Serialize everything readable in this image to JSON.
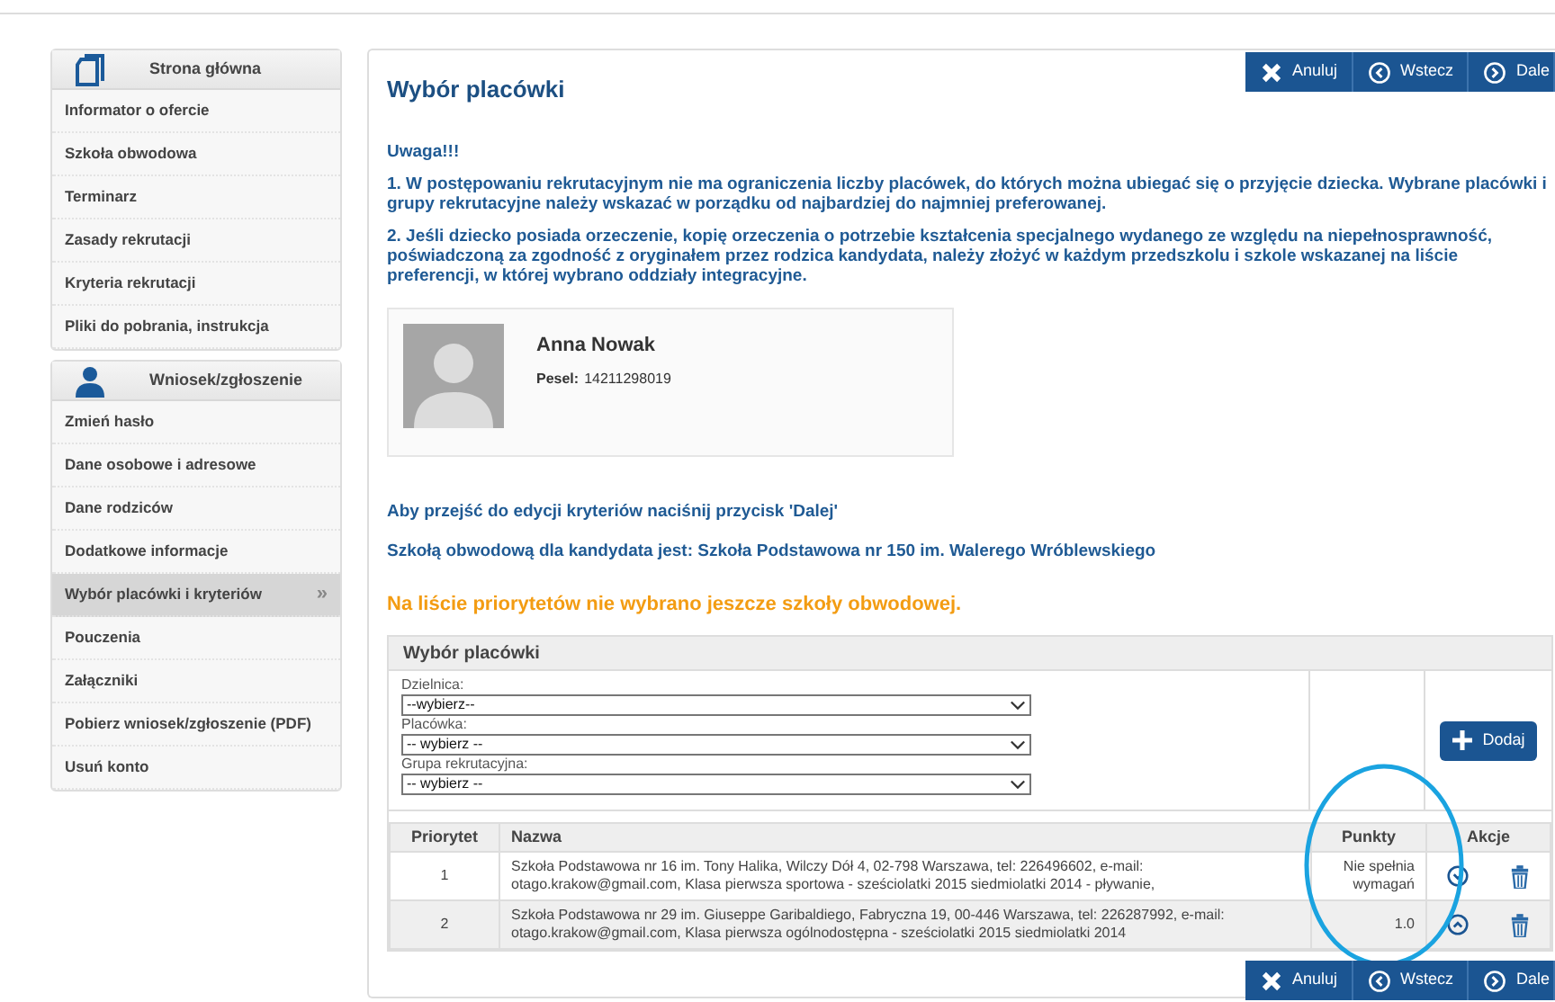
{
  "sidebar": {
    "sections": [
      {
        "title": "Strona główna",
        "items": [
          {
            "label": "Informator o ofercie",
            "selected": false
          },
          {
            "label": "Szkoła obwodowa",
            "selected": false
          },
          {
            "label": "Terminarz",
            "selected": false
          },
          {
            "label": "Zasady rekrutacji",
            "selected": false
          },
          {
            "label": "Kryteria rekrutacji",
            "selected": false
          },
          {
            "label": "Pliki do pobrania, instrukcja",
            "selected": false
          }
        ]
      },
      {
        "title": "Wniosek/zgłoszenie",
        "items": [
          {
            "label": "Zmień hasło",
            "selected": false
          },
          {
            "label": "Dane osobowe i adresowe",
            "selected": false
          },
          {
            "label": "Dane rodziców",
            "selected": false
          },
          {
            "label": "Dodatkowe informacje",
            "selected": false
          },
          {
            "label": "Wybór placówki i kryteriów",
            "selected": true,
            "arrow": "»"
          },
          {
            "label": "Pouczenia",
            "selected": false
          },
          {
            "label": "Załączniki",
            "selected": false
          },
          {
            "label": "Pobierz wniosek/zgłoszenie (PDF)",
            "selected": false
          },
          {
            "label": "Usuń konto",
            "selected": false
          }
        ]
      }
    ]
  },
  "toolbar_top": {
    "buttons": [
      {
        "kind": "cancel",
        "label": "Anuluj"
      },
      {
        "kind": "back",
        "label": "Wstecz"
      },
      {
        "kind": "next",
        "label": "Dale"
      }
    ]
  },
  "main": {
    "title": "Wybór placówki",
    "notice_heading": "Uwaga!!!",
    "notices": [
      "1. W postępowaniu rekrutacyjnym nie ma ograniczenia liczby placówek, do których można ubiegać się o przyjęcie dziecka. Wybrane placówki i grupy rekrutacyjne należy wskazać w porządku od najbardziej do najmniej preferowanej.",
      "2. Jeśli dziecko posiada orzeczenie, kopię orzeczenia o potrzebie kształcenia specjalnego wydanego ze względu na niepełnosprawność, poświadczoną za zgodność z oryginałem przez rodzica kandydata, należy złożyć w każdym przedszkolu i szkole wskazanej na liście preferencji, w której wybrano oddziały integracyjne."
    ],
    "profile": {
      "name": "Anna Nowak",
      "pesel_label": "Pesel:",
      "pesel": "14211298019"
    },
    "instruction": "Aby przejść do edycji kryteriów naciśnij przycisk 'Dalej'",
    "district_school": "Szkołą obwodową dla kandydata jest: Szkoła Podstawowa nr 150 im. Walerego Wróblewskiego",
    "warning": "Na liście priorytetów nie wybrano jeszcze szkoły obwodowej."
  },
  "selection": {
    "title": "Wybór placówki",
    "fields": [
      {
        "label": "Dzielnica:",
        "value": "--wybierz--"
      },
      {
        "label": "Placówka:",
        "value": "-- wybierz --"
      },
      {
        "label": "Grupa rekrutacyjna:",
        "value": "-- wybierz --"
      }
    ],
    "add_button": "Dodaj"
  },
  "table": {
    "columns": [
      "Priorytet",
      "Nazwa",
      "Punkty",
      "Akcje"
    ],
    "rows": [
      {
        "priority": "1",
        "name": "Szkoła Podstawowa nr 16 im. Tony Halika, Wilczy Dół 4, 02-798 Warszawa, tel: 226496602, e-mail: otago.krakow@gmail.com, Klasa pierwsza sportowa - sześciolatki 2015 siedmiolatki 2014 - pływanie,",
        "points": "Nie spełnia wymagań"
      },
      {
        "priority": "2",
        "name": "Szkoła Podstawowa nr 29 im. Giuseppe Garibaldiego, Fabryczna 19, 00-446 Warszawa, tel: 226287992, e-mail: otago.krakow@gmail.com, Klasa pierwsza ogólnodostępna - sześciolatki 2015 siedmiolatki 2014",
        "points": "1.0"
      }
    ]
  },
  "annotation": {
    "kind": "circle"
  },
  "toolbar_bottom": {
    "buttons": [
      {
        "kind": "cancel",
        "label": "Anuluj"
      },
      {
        "kind": "back",
        "label": "Wstecz"
      },
      {
        "kind": "next",
        "label": "Dale"
      }
    ]
  }
}
